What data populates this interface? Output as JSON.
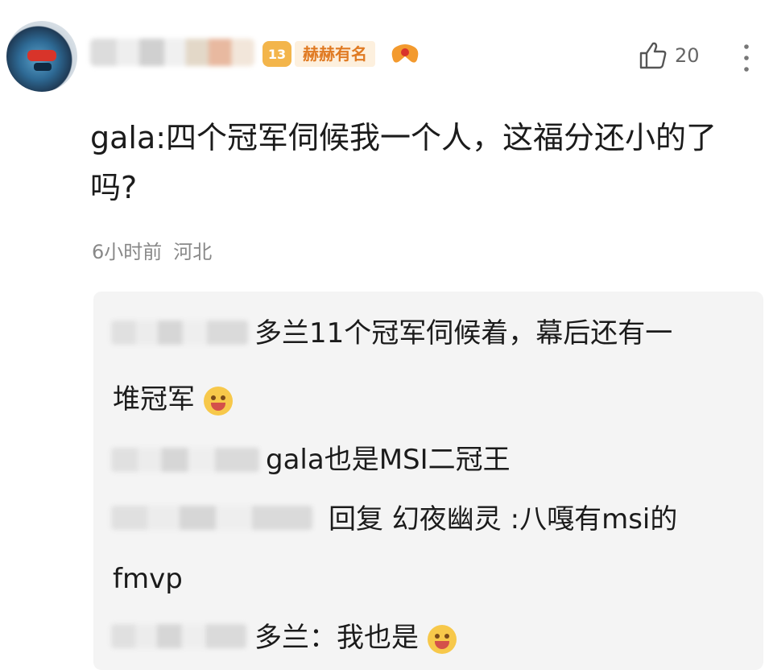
{
  "comment": {
    "level_number": "13",
    "level_title": "赫赫有名",
    "like_count": "20",
    "text": "gala:四个冠军伺候我一个人，这福分还小的了吗?",
    "time": "6小时前",
    "location": "河北"
  },
  "replies": [
    {
      "line1": "多兰11个冠军伺候着，幕后还有一",
      "line2": "堆冠军",
      "emoji": "grinning-squint-emoji"
    },
    {
      "line1": "gala也是MSI二冠王"
    },
    {
      "line1": "回复 幻夜幽灵 :八嘎有msi的",
      "line2": "fmvp"
    },
    {
      "line1": "多兰：我也是",
      "emoji": "yum-tongue-emoji"
    }
  ],
  "colors": {
    "level_badge": "#f3b54b",
    "level_title": "#e07a22",
    "meta": "#888888",
    "reply_bg": "#f4f4f4"
  }
}
